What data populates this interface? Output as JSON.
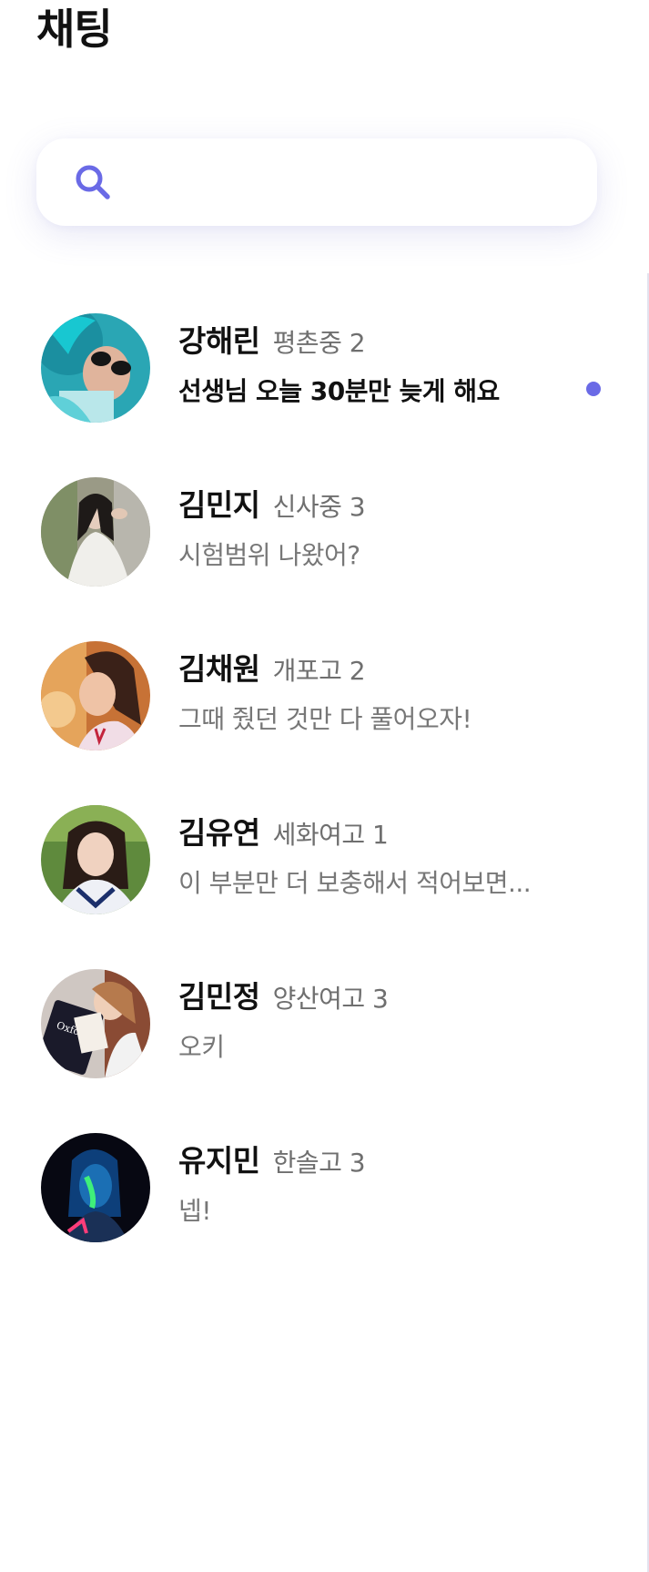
{
  "header": {
    "title": "채팅"
  },
  "search": {
    "icon": "search-icon",
    "accent": "#6a6ae6",
    "value": ""
  },
  "chats": [
    {
      "name": "강해린",
      "school": "평촌중 2",
      "message": "선생님 오늘 30분만 늦게 해요",
      "unread": true
    },
    {
      "name": "김민지",
      "school": "신사중 3",
      "message": "시험범위 나왔어?",
      "unread": false
    },
    {
      "name": "김채원",
      "school": "개포고 2",
      "message": "그때 줬던 것만 다 풀어오자!",
      "unread": false
    },
    {
      "name": "김유연",
      "school": "세화여고 1",
      "message": "이 부분만 더 보충해서 적어보면...",
      "unread": false
    },
    {
      "name": "김민정",
      "school": "양산여고 3",
      "message": "오키",
      "unread": false
    },
    {
      "name": "유지민",
      "school": "한솔고 3",
      "message": "넵!",
      "unread": false
    }
  ],
  "colors": {
    "unread_dot": "#6a6ae6",
    "muted_text": "#777777",
    "title": "#111111"
  }
}
